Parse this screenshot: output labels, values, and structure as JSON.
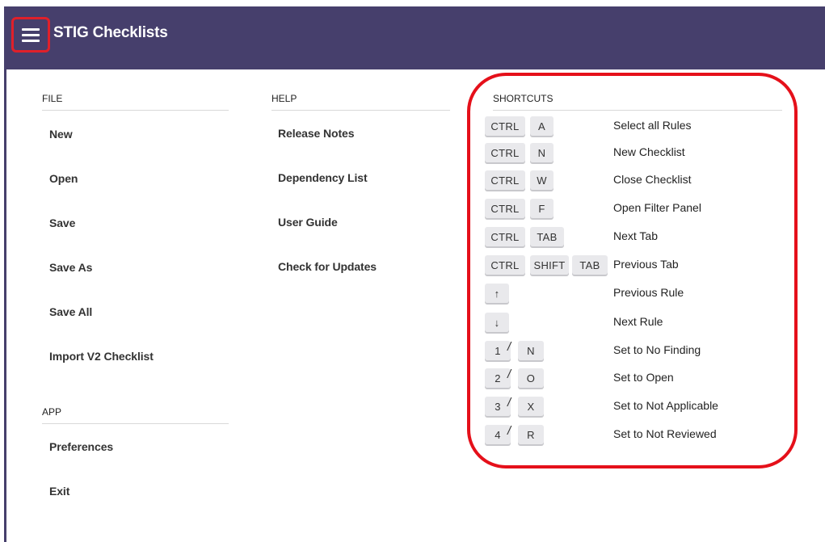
{
  "header": {
    "title": "STIG Checklists",
    "menu_icon": "hamburger-menu-icon"
  },
  "file": {
    "heading": "FILE",
    "items": [
      "New",
      "Open",
      "Save",
      "Save As",
      "Save All",
      "Import V2 Checklist"
    ]
  },
  "app_menu": {
    "heading": "APP",
    "items": [
      "Preferences",
      "Exit"
    ]
  },
  "help": {
    "heading": "HELP",
    "items": [
      "Release Notes",
      "Dependency List",
      "User Guide",
      "Check for Updates"
    ]
  },
  "shortcuts": {
    "heading": "SHORTCUTS",
    "rows": [
      {
        "keys": [
          "CTRL",
          "A"
        ],
        "desc": "Select all Rules"
      },
      {
        "keys": [
          "CTRL",
          "N"
        ],
        "desc": "New Checklist"
      },
      {
        "keys": [
          "CTRL",
          "W"
        ],
        "desc": "Close Checklist"
      },
      {
        "keys": [
          "CTRL",
          "F"
        ],
        "desc": "Open Filter Panel"
      },
      {
        "keys": [
          "CTRL",
          "TAB"
        ],
        "desc": "Next Tab"
      },
      {
        "keys": [
          "CTRL",
          "SHIFT",
          "TAB"
        ],
        "desc": "Previous Tab"
      },
      {
        "keys": [
          "↑"
        ],
        "desc": "Previous Rule"
      },
      {
        "keys": [
          "↓"
        ],
        "desc": "Next Rule"
      },
      {
        "keys": [
          "1",
          "N"
        ],
        "sep": "/",
        "desc": "Set to No Finding"
      },
      {
        "keys": [
          "2",
          "O"
        ],
        "sep": "/",
        "desc": "Set to Open"
      },
      {
        "keys": [
          "3",
          "X"
        ],
        "sep": "/",
        "desc": "Set to Not Applicable"
      },
      {
        "keys": [
          "4",
          "R"
        ],
        "sep": "/",
        "desc": "Set to Not Reviewed"
      }
    ]
  },
  "colors": {
    "header_bg": "#463f6c",
    "highlight": "#e5101a",
    "key_bg": "#e9e9ec"
  }
}
